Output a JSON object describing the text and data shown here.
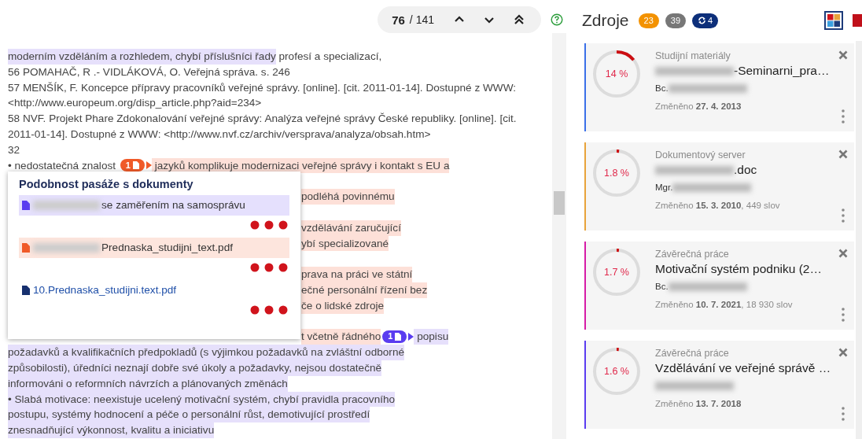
{
  "navigator": {
    "current": "76",
    "total": "/ 141"
  },
  "document": {
    "lines": [
      {
        "kind": "text",
        "segments": [
          {
            "text": "moderním vzděláním a rozhledem, chybí příslušníci řady",
            "color": "#e6e0fb"
          },
          {
            "text": " profesí a specializací,"
          }
        ]
      },
      {
        "kind": "text",
        "segments": [
          {
            "text": "56 POMAHAČ, R .- VIDLÁKOVÁ, O. Veřejná správa. s. 246"
          }
        ]
      },
      {
        "kind": "text",
        "segments": [
          {
            "text": "57 MENŠÍK, F. Koncepce přípravy pracovníků veřejné správy. [online]. [cit. 2011-01-14]. Dostupné z WWW:"
          }
        ]
      },
      {
        "kind": "text",
        "segments": [
          {
            "text": "<http://www.europeum.org/disp_article.php?aid=234>"
          }
        ]
      },
      {
        "kind": "text",
        "segments": [
          {
            "text": "58 NVF. Projekt Phare Zdokonalování veřejné správy: Analýza veřejné správy České republiky. [online]. [cit."
          }
        ]
      },
      {
        "kind": "text",
        "segments": [
          {
            "text": "2011-01-14]. Dostupné z WWW: <http://www.nvf.cz/archiv/versprava/analyza/obsah.htm>"
          }
        ]
      },
      {
        "kind": "text",
        "segments": [
          {
            "text": "32"
          }
        ]
      },
      {
        "kind": "text",
        "segments": [
          {
            "text": "• nedostatečná znalost "
          },
          {
            "kind": "badge",
            "text": "1",
            "color": "#f05a28"
          },
          {
            "text": " jazyků komplikuje modernizaci veřejné správy i kontakt s EU a",
            "color": "#fde0d8"
          }
        ]
      },
      {
        "kind": "hidden"
      },
      {
        "kind": "fragment",
        "segments": [
          {
            "text": "podléhá povinnému",
            "color": "#fde0d8"
          }
        ]
      },
      {
        "kind": "hidden"
      },
      {
        "kind": "fragment",
        "segments": [
          {
            "text": "vzdělávání zaručující",
            "color": "#fde0d8"
          }
        ]
      },
      {
        "kind": "fragment",
        "segments": [
          {
            "text": "ybí specializované",
            "color": "#fde0d8"
          }
        ]
      },
      {
        "kind": "hidden"
      },
      {
        "kind": "fragment",
        "segments": [
          {
            "text": "prava na práci ve státní",
            "color": "#fde0d8"
          }
        ]
      },
      {
        "kind": "fragment",
        "segments": [
          {
            "text": "ečné personální řízení bez",
            "color": "#fde0d8"
          }
        ]
      },
      {
        "kind": "fragment",
        "segments": [
          {
            "text": "če o lidské zdroje",
            "color": "#fde0d8"
          }
        ]
      },
      {
        "kind": "hidden"
      },
      {
        "kind": "fragment",
        "segments": [
          {
            "text": "t včetně řádného",
            "color": "#fde0d8"
          },
          {
            "kind": "badge",
            "text": "1",
            "color": "#5a3cf0"
          },
          {
            "text": " popisu",
            "color": "#e6e0fb"
          }
        ]
      },
      {
        "kind": "text",
        "segments": [
          {
            "text": "požadavků a kvalifikačních předpokladů (s výjimkou požadavků na zvláštní odborné",
            "color": "#e6e0fb"
          }
        ]
      },
      {
        "kind": "text",
        "segments": [
          {
            "text": "způsobilosti), úředníci neznají dobře své úkoly a požadavky, nejsou dostatečně",
            "color": "#e6e0fb"
          }
        ]
      },
      {
        "kind": "text",
        "segments": [
          {
            "text": "informováni o reformních návrzích a plánovaných změnách",
            "color": "#e6e0fb"
          }
        ]
      },
      {
        "kind": "text",
        "segments": [
          {
            "text": "• Slabá motivace: neexistuje ucelený motivační systém, chybí pravidla pracovního",
            "color": "#e6e0fb"
          }
        ]
      },
      {
        "kind": "text",
        "segments": [
          {
            "text": "postupu, systémy hodnocení a péče o personální růst, demotivující prostředí",
            "color": "#e6e0fb"
          }
        ]
      },
      {
        "kind": "text",
        "segments": [
          {
            "text": "znesnadňující výkonnost, kvalitu a iniciativu",
            "color": "#e6e0fb"
          }
        ]
      }
    ]
  },
  "popup": {
    "title": "Podobnost pasáže s dokumenty",
    "items": [
      {
        "name": "se zaměřením na samosprávu",
        "redacted": true,
        "color": "#5a3cf0",
        "highlighted": true
      },
      {
        "name": "Prednaska_studijni_text.pdf",
        "redacted": true,
        "color": "#f05a28",
        "highlighted": true
      },
      {
        "name": "10.Prednaska_studijni.text.pdf",
        "redacted": false,
        "color": "#17306e",
        "highlighted": false
      }
    ]
  },
  "sources": {
    "title": "Zdroje",
    "badges": [
      {
        "text": "23",
        "kind": "count",
        "color": "#f39200"
      },
      {
        "text": "39",
        "kind": "count",
        "color": "#777777"
      },
      {
        "text": "4",
        "kind": "sync",
        "color": "#0d2f7a"
      }
    ],
    "views": [
      {
        "kind": "grid",
        "selected": true
      },
      {
        "kind": "single",
        "selected": false
      }
    ],
    "cards": [
      {
        "percent": "14 %",
        "level": 0.14,
        "color": "#3a6fe8",
        "category": "Studijní materiály",
        "title": "-Seminarni_pra…",
        "title_redacted": true,
        "author": "Bc.",
        "author_redacted": true,
        "changed": "Změněno **27. 4. 2013**"
      },
      {
        "percent": "1.8 %",
        "level": 0.018,
        "color": "#e8a33a",
        "category": "Dokumentový server",
        "title": ".doc",
        "title_redacted": true,
        "author": "Mgr.",
        "author_redacted": true,
        "changed": "Změněno **15. 3. 2010**, 449 slov"
      },
      {
        "percent": "1.7 %",
        "level": 0.017,
        "color": "#d61ba6",
        "category": "Závěrečná práce",
        "title": "Motivační systém podniku (2…",
        "title_redacted": false,
        "author": "Bc.",
        "author_redacted": true,
        "changed": "Změněno **10. 7. 2021**, 18 930 slov"
      },
      {
        "percent": "1.6 %",
        "level": 0.016,
        "color": "#5a3cf0",
        "category": "Závěrečná práce",
        "title": "Vzdělávání ve veřejné správě …",
        "title_redacted": false,
        "author_redacted": true,
        "changed": "Změněno **13. 7. 2018**"
      }
    ]
  }
}
